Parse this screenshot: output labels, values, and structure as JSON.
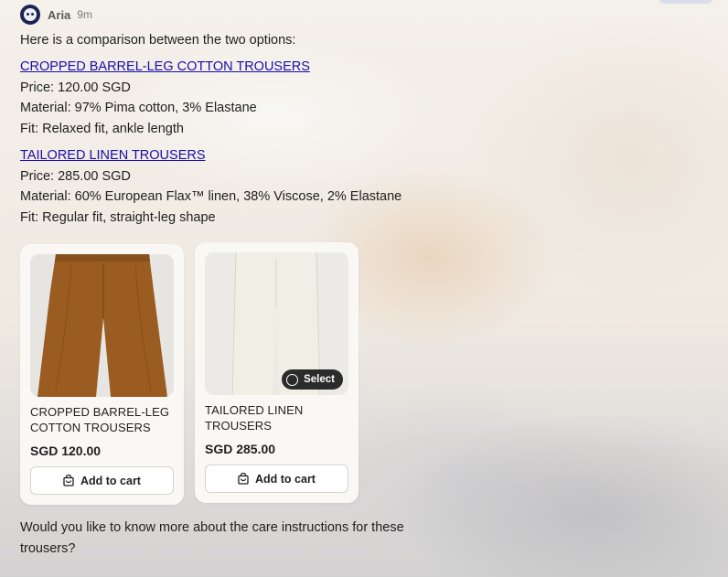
{
  "header": {
    "sender": "Aria",
    "time": "9m"
  },
  "message": {
    "intro": "Here is a comparison between the two options:",
    "products": [
      {
        "link": "CROPPED BARREL-LEG COTTON TROUSERS",
        "price_line": "Price: 120.00 SGD",
        "material_line": "Material: 97% Pima cotton, 3% Elastane",
        "fit_line": "Fit: Relaxed fit, ankle length"
      },
      {
        "link": "TAILORED LINEN TROUSERS",
        "price_line": "Price: 285.00 SGD",
        "material_line": "Material: 60% European Flax™ linen, 38% Viscose, 2% Elastane",
        "fit_line": "Fit: Regular fit, straight-leg shape"
      }
    ],
    "outro": "Would you like to know more about the care instructions for these trousers?"
  },
  "cards": [
    {
      "name": "CROPPED BARREL-LEG COTTON TROUSERS",
      "price": "SGD 120.00",
      "cart_label": "Add to cart",
      "image_color": "#9a5c20"
    },
    {
      "name": "TAILORED LINEN TROUSERS",
      "price": "SGD 285.00",
      "cart_label": "Add to cart",
      "select_label": "Select",
      "image_color": "#efece4"
    }
  ],
  "icons": {
    "avatar": "bot-avatar-icon",
    "cart": "shopping-bag-icon",
    "select": "radio-circle-icon"
  }
}
